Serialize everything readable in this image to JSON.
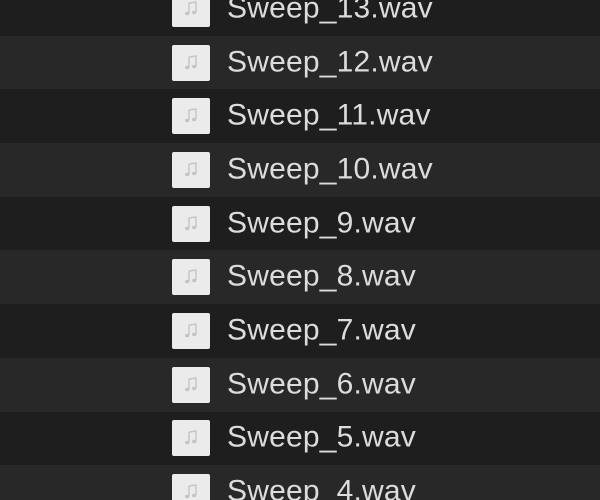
{
  "files": [
    {
      "name": "Sweep_13.wav",
      "icon": "audio-file-icon"
    },
    {
      "name": "Sweep_12.wav",
      "icon": "audio-file-icon"
    },
    {
      "name": "Sweep_11.wav",
      "icon": "audio-file-icon"
    },
    {
      "name": "Sweep_10.wav",
      "icon": "audio-file-icon"
    },
    {
      "name": "Sweep_9.wav",
      "icon": "audio-file-icon"
    },
    {
      "name": "Sweep_8.wav",
      "icon": "audio-file-icon"
    },
    {
      "name": "Sweep_7.wav",
      "icon": "audio-file-icon"
    },
    {
      "name": "Sweep_6.wav",
      "icon": "audio-file-icon"
    },
    {
      "name": "Sweep_5.wav",
      "icon": "audio-file-icon"
    },
    {
      "name": "Sweep_4.wav",
      "icon": "audio-file-icon"
    }
  ],
  "colors": {
    "background": "#1e1e1e",
    "row_alt": "#282828",
    "text": "#dcdcdc",
    "icon_bg": "#ebebeb"
  }
}
